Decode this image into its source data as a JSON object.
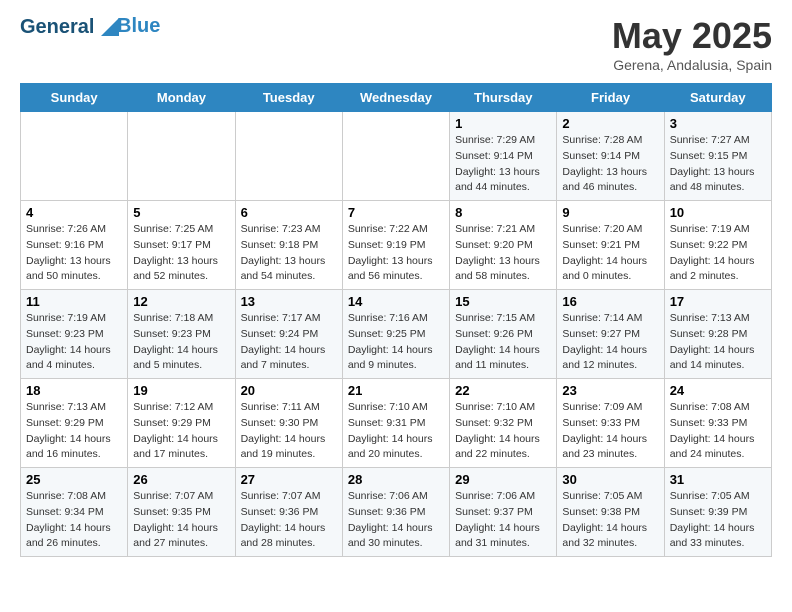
{
  "header": {
    "logo_line1": "General",
    "logo_line2": "Blue",
    "title": "May 2025",
    "location": "Gerena, Andalusia, Spain"
  },
  "days_of_week": [
    "Sunday",
    "Monday",
    "Tuesday",
    "Wednesday",
    "Thursday",
    "Friday",
    "Saturday"
  ],
  "weeks": [
    [
      {
        "day": "",
        "info": ""
      },
      {
        "day": "",
        "info": ""
      },
      {
        "day": "",
        "info": ""
      },
      {
        "day": "",
        "info": ""
      },
      {
        "day": "1",
        "info": "Sunrise: 7:29 AM\nSunset: 9:14 PM\nDaylight: 13 hours\nand 44 minutes."
      },
      {
        "day": "2",
        "info": "Sunrise: 7:28 AM\nSunset: 9:14 PM\nDaylight: 13 hours\nand 46 minutes."
      },
      {
        "day": "3",
        "info": "Sunrise: 7:27 AM\nSunset: 9:15 PM\nDaylight: 13 hours\nand 48 minutes."
      }
    ],
    [
      {
        "day": "4",
        "info": "Sunrise: 7:26 AM\nSunset: 9:16 PM\nDaylight: 13 hours\nand 50 minutes."
      },
      {
        "day": "5",
        "info": "Sunrise: 7:25 AM\nSunset: 9:17 PM\nDaylight: 13 hours\nand 52 minutes."
      },
      {
        "day": "6",
        "info": "Sunrise: 7:23 AM\nSunset: 9:18 PM\nDaylight: 13 hours\nand 54 minutes."
      },
      {
        "day": "7",
        "info": "Sunrise: 7:22 AM\nSunset: 9:19 PM\nDaylight: 13 hours\nand 56 minutes."
      },
      {
        "day": "8",
        "info": "Sunrise: 7:21 AM\nSunset: 9:20 PM\nDaylight: 13 hours\nand 58 minutes."
      },
      {
        "day": "9",
        "info": "Sunrise: 7:20 AM\nSunset: 9:21 PM\nDaylight: 14 hours\nand 0 minutes."
      },
      {
        "day": "10",
        "info": "Sunrise: 7:19 AM\nSunset: 9:22 PM\nDaylight: 14 hours\nand 2 minutes."
      }
    ],
    [
      {
        "day": "11",
        "info": "Sunrise: 7:19 AM\nSunset: 9:23 PM\nDaylight: 14 hours\nand 4 minutes."
      },
      {
        "day": "12",
        "info": "Sunrise: 7:18 AM\nSunset: 9:23 PM\nDaylight: 14 hours\nand 5 minutes."
      },
      {
        "day": "13",
        "info": "Sunrise: 7:17 AM\nSunset: 9:24 PM\nDaylight: 14 hours\nand 7 minutes."
      },
      {
        "day": "14",
        "info": "Sunrise: 7:16 AM\nSunset: 9:25 PM\nDaylight: 14 hours\nand 9 minutes."
      },
      {
        "day": "15",
        "info": "Sunrise: 7:15 AM\nSunset: 9:26 PM\nDaylight: 14 hours\nand 11 minutes."
      },
      {
        "day": "16",
        "info": "Sunrise: 7:14 AM\nSunset: 9:27 PM\nDaylight: 14 hours\nand 12 minutes."
      },
      {
        "day": "17",
        "info": "Sunrise: 7:13 AM\nSunset: 9:28 PM\nDaylight: 14 hours\nand 14 minutes."
      }
    ],
    [
      {
        "day": "18",
        "info": "Sunrise: 7:13 AM\nSunset: 9:29 PM\nDaylight: 14 hours\nand 16 minutes."
      },
      {
        "day": "19",
        "info": "Sunrise: 7:12 AM\nSunset: 9:29 PM\nDaylight: 14 hours\nand 17 minutes."
      },
      {
        "day": "20",
        "info": "Sunrise: 7:11 AM\nSunset: 9:30 PM\nDaylight: 14 hours\nand 19 minutes."
      },
      {
        "day": "21",
        "info": "Sunrise: 7:10 AM\nSunset: 9:31 PM\nDaylight: 14 hours\nand 20 minutes."
      },
      {
        "day": "22",
        "info": "Sunrise: 7:10 AM\nSunset: 9:32 PM\nDaylight: 14 hours\nand 22 minutes."
      },
      {
        "day": "23",
        "info": "Sunrise: 7:09 AM\nSunset: 9:33 PM\nDaylight: 14 hours\nand 23 minutes."
      },
      {
        "day": "24",
        "info": "Sunrise: 7:08 AM\nSunset: 9:33 PM\nDaylight: 14 hours\nand 24 minutes."
      }
    ],
    [
      {
        "day": "25",
        "info": "Sunrise: 7:08 AM\nSunset: 9:34 PM\nDaylight: 14 hours\nand 26 minutes."
      },
      {
        "day": "26",
        "info": "Sunrise: 7:07 AM\nSunset: 9:35 PM\nDaylight: 14 hours\nand 27 minutes."
      },
      {
        "day": "27",
        "info": "Sunrise: 7:07 AM\nSunset: 9:36 PM\nDaylight: 14 hours\nand 28 minutes."
      },
      {
        "day": "28",
        "info": "Sunrise: 7:06 AM\nSunset: 9:36 PM\nDaylight: 14 hours\nand 30 minutes."
      },
      {
        "day": "29",
        "info": "Sunrise: 7:06 AM\nSunset: 9:37 PM\nDaylight: 14 hours\nand 31 minutes."
      },
      {
        "day": "30",
        "info": "Sunrise: 7:05 AM\nSunset: 9:38 PM\nDaylight: 14 hours\nand 32 minutes."
      },
      {
        "day": "31",
        "info": "Sunrise: 7:05 AM\nSunset: 9:39 PM\nDaylight: 14 hours\nand 33 minutes."
      }
    ]
  ]
}
